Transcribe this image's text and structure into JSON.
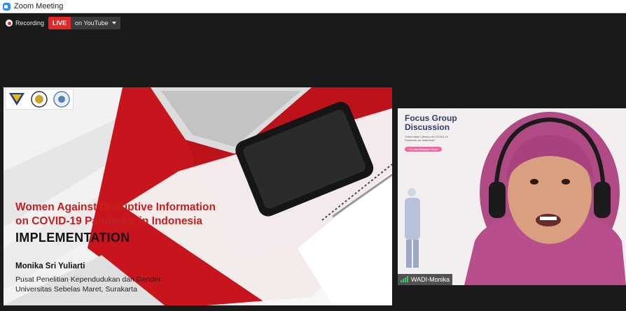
{
  "window": {
    "title": "Zoom Meeting"
  },
  "recording": {
    "label": "Recording",
    "live_label": "LIVE",
    "destination": "on YouTube"
  },
  "slide": {
    "title_line1": "Women Against Disruptive Information",
    "title_line2": "on COVID-19 Pandemic in Indonesia",
    "subtitle": "IMPLEMENTATION",
    "author": "Monika Sri Yuliarti",
    "institution_line1": "Pusat Penelitian Kependudukan dan Gender",
    "institution_line2": "Universitas Sebelas Maret, Surakarta"
  },
  "participant": {
    "name": "WADI-Monika",
    "background_title_line1": "Focus Group",
    "background_title_line2": "Discussion",
    "background_subtitle": "\"Information Literacy on COVID-19 Pandemic on Indonesia\"",
    "background_pill": "\"Cerdas Melawan Hoax\""
  },
  "colors": {
    "zoom_blue": "#2d8cff",
    "live_red": "#e02828",
    "slide_title_red": "#c42020",
    "signal_green": "#2fd05a"
  },
  "icons": {
    "app": "zoom-app-icon",
    "recording": "recording-dot-icon",
    "dropdown": "chevron-down-icon",
    "signal": "signal-strength-icon"
  }
}
